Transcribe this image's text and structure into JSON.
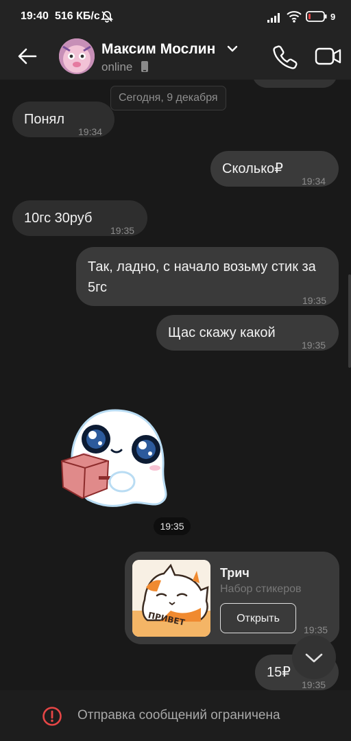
{
  "status_bar": {
    "time": "19:40",
    "speed": "516 КБ/с",
    "battery": "9",
    "icons": [
      "bell-off-icon",
      "signal-icon",
      "wifi-icon",
      "battery-icon"
    ]
  },
  "header": {
    "contact_name": "Максим Мослин",
    "status": "online",
    "icons": [
      "back-arrow-icon",
      "chevron-down-icon",
      "mobile-icon",
      "phone-icon",
      "video-icon"
    ]
  },
  "chat": {
    "date_separator": "Сегодня, 9 декабря",
    "messages": [
      {
        "direction": "incoming",
        "text": "Понял",
        "time": "19:34"
      },
      {
        "direction": "outgoing",
        "text": "Сколько₽",
        "time": "19:34"
      },
      {
        "direction": "incoming",
        "text": "10гс 30руб",
        "time": "19:35"
      },
      {
        "direction": "outgoing",
        "text": "Так, ладно, с начало возьму стик за 5гс",
        "time": "19:35"
      },
      {
        "direction": "outgoing",
        "text": "Щас скажу какой",
        "time": "19:35"
      },
      {
        "direction": "incoming",
        "type": "sticker",
        "sticker": "ghost-with-box",
        "time": "19:35"
      },
      {
        "direction": "outgoing",
        "type": "sticker-pack",
        "title": "Трич",
        "subtitle": "Набор стикеров",
        "button": "Открыть",
        "thumbnail_text": "ПРИВЕТ",
        "time": "19:35"
      },
      {
        "direction": "outgoing",
        "text": "15₽",
        "time": "19:35"
      }
    ]
  },
  "bottom_bar": {
    "text": "Отправка сообщений ограничена",
    "icon": "alert-circle-icon",
    "accent": "#e64646"
  },
  "colors": {
    "background": "#191919",
    "bar": "#232323",
    "bubble_in": "#2e2e2e",
    "bubble_out": "#3a3a3a"
  }
}
